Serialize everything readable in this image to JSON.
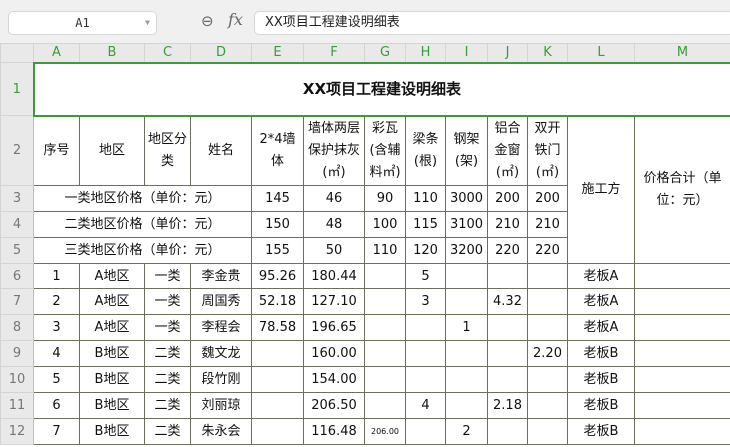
{
  "namebox": "A1",
  "formula": "XX项目工程建设明细表",
  "columns": [
    "A",
    "B",
    "C",
    "D",
    "E",
    "F",
    "G",
    "H",
    "I",
    "J",
    "K",
    "L",
    "M"
  ],
  "row_numbers": [
    "1",
    "2",
    "3",
    "4",
    "5",
    "6",
    "7",
    "8",
    "9",
    "10",
    "11",
    "12"
  ],
  "title": "XX项目工程建设明细表",
  "headers": [
    "序号",
    "地区",
    "地区分类",
    "姓名",
    "2*4墙体",
    "墙体两层保护抹灰(㎡)",
    "彩瓦(含辅料㎡)",
    "梁条(根)",
    "钢架(架)",
    "铝合金窗(㎡)",
    "双开铁门(㎡)",
    "施工方",
    "价格合计（单位：元）"
  ],
  "price_rows": [
    {
      "label": "一类地区价格（单价：元）",
      "values": [
        "145",
        "46",
        "90",
        "110",
        "3000",
        "200",
        "200"
      ]
    },
    {
      "label": "二类地区价格（单价：元）",
      "values": [
        "150",
        "48",
        "100",
        "115",
        "3100",
        "210",
        "210"
      ]
    },
    {
      "label": "三类地区价格（单价：元）",
      "values": [
        "155",
        "50",
        "110",
        "120",
        "3200",
        "220",
        "220"
      ]
    }
  ],
  "rows": [
    [
      "1",
      "A地区",
      "一类",
      "李金贵",
      "95.26",
      "180.44",
      "",
      "5",
      "",
      "",
      "",
      "老板A",
      ""
    ],
    [
      "2",
      "A地区",
      "一类",
      "周国秀",
      "52.18",
      "127.10",
      "",
      "3",
      "",
      "4.32",
      "",
      "老板A",
      ""
    ],
    [
      "3",
      "A地区",
      "一类",
      "李程会",
      "78.58",
      "196.65",
      "",
      "",
      "1",
      "",
      "",
      "老板A",
      ""
    ],
    [
      "4",
      "B地区",
      "二类",
      "魏文龙",
      "",
      "160.00",
      "",
      "",
      "",
      "",
      "2.20",
      "老板B",
      ""
    ],
    [
      "5",
      "B地区",
      "二类",
      "段竹刚",
      "",
      "154.00",
      "",
      "",
      "",
      "",
      "",
      "老板B",
      ""
    ],
    [
      "6",
      "B地区",
      "二类",
      "刘丽琼",
      "",
      "206.50",
      "",
      "4",
      "",
      "2.18",
      "",
      "老板B",
      ""
    ],
    [
      "7",
      "B地区",
      "二类",
      "朱永会",
      "",
      "116.48",
      "206.00",
      "",
      "2",
      "",
      "",
      "老板B",
      ""
    ]
  ]
}
